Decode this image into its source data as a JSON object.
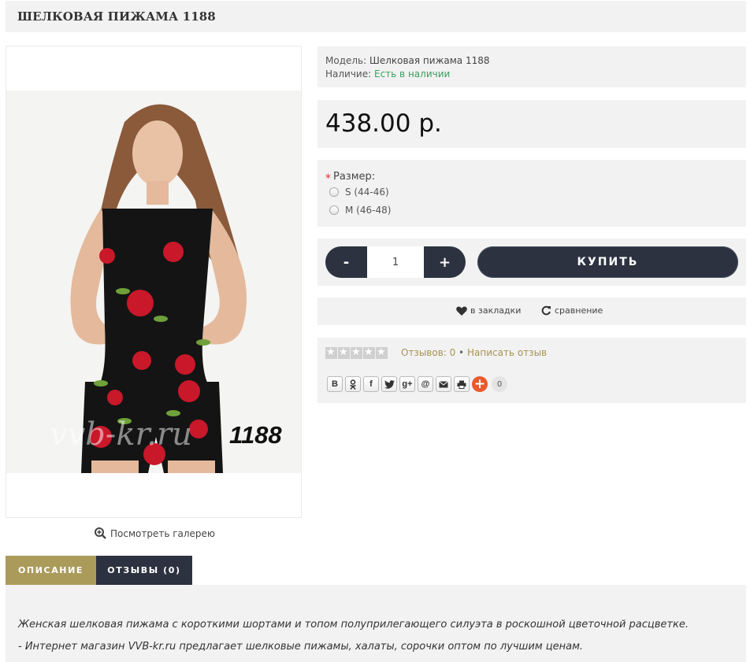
{
  "product": {
    "title": "ШЕЛКОВАЯ ПИЖАМА 1188",
    "image_code": "1188",
    "watermark": "vvb-kr.ru",
    "gallery_link": "Посмотреть галерею"
  },
  "info": {
    "model_label": "Модель:",
    "model_value": "Шелковая пижама 1188",
    "stock_label": "Наличие:",
    "stock_value": "Есть в наличии",
    "stock_color": "#3aa05f"
  },
  "price": "438.00 р.",
  "options": {
    "required_mark": "*",
    "label": "Размер:",
    "sizes": [
      "S (44-46)",
      "M (46-48)"
    ]
  },
  "cart": {
    "minus": "-",
    "quantity": "1",
    "plus": "+",
    "buy_label": "КУПИТЬ"
  },
  "actions": {
    "wishlist": "в закладки",
    "compare": "сравнение"
  },
  "reviews": {
    "rating": 0,
    "count_text": "Отзывов: 0",
    "separator": "•",
    "write_text": "Написать отзыв"
  },
  "share": {
    "buttons": [
      "В",
      "ok-icon",
      "f",
      "twitter-icon",
      "g+",
      "@",
      "mail-icon",
      "print-icon"
    ],
    "count": "0",
    "plus": "+"
  },
  "tabs": [
    {
      "label": "ОПИСАНИЕ"
    },
    {
      "label": "ОТЗЫВЫ (0)"
    }
  ],
  "description": {
    "line1": "Женская шелковая пижама с короткими шортами и топом полуприлегающего силуэта в роскошной цветочной расцветке.",
    "line2": "- Интернет магазин VVB-kr.ru предлагает шелковые пижамы, халаты, сорочки оптом  по лучшим ценам."
  },
  "colors": {
    "accent_gold": "#ab9b5b",
    "dark_navy": "#2d3240",
    "panel_bg": "#f2f2f2",
    "link_gold": "#a69350"
  }
}
